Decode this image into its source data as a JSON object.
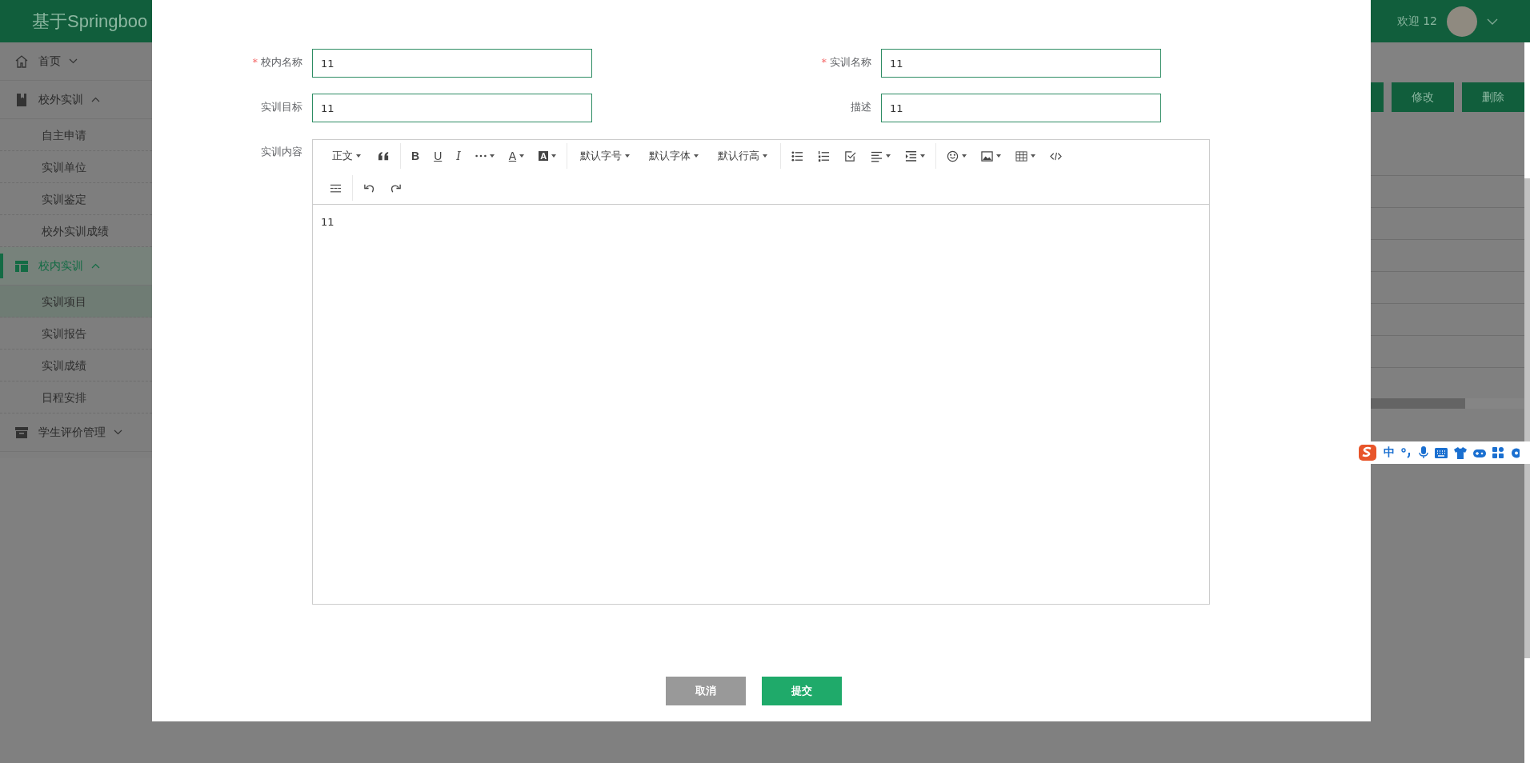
{
  "header": {
    "title": "基于Springboo",
    "welcome": "欢迎 12"
  },
  "sidebar": {
    "items": [
      {
        "label": "首页",
        "expanded": false,
        "selected": false
      },
      {
        "label": "校外实训",
        "expanded": true,
        "selected": false,
        "children": [
          {
            "label": "自主申请",
            "selected": false
          },
          {
            "label": "实训单位",
            "selected": false
          },
          {
            "label": "实训鉴定",
            "selected": false
          },
          {
            "label": "校外实训成绩",
            "selected": false
          }
        ]
      },
      {
        "label": "校内实训",
        "expanded": true,
        "selected": true,
        "children": [
          {
            "label": "实训项目",
            "selected": true
          },
          {
            "label": "实训报告",
            "selected": false
          },
          {
            "label": "实训成绩",
            "selected": false
          },
          {
            "label": "日程安排",
            "selected": false
          }
        ]
      },
      {
        "label": "学生评价管理",
        "expanded": false,
        "selected": false
      }
    ]
  },
  "background_buttons": [
    "修改",
    "删除"
  ],
  "modal": {
    "required_mark": "*",
    "fields": [
      {
        "label": "校内名称",
        "required": true,
        "value": "11"
      },
      {
        "label": "实训名称",
        "required": true,
        "value": "11"
      },
      {
        "label": "实训目标",
        "required": false,
        "value": "11"
      },
      {
        "label": "描述",
        "required": false,
        "value": "11"
      }
    ],
    "editor": {
      "label": "实训内容",
      "content": "11",
      "toolbar_rows": [
        [
          [
            {
              "kind": "dropdown",
              "label": "正文"
            },
            {
              "kind": "quote"
            }
          ],
          [
            {
              "kind": "bold",
              "label": "B"
            },
            {
              "kind": "underline",
              "label": "U"
            },
            {
              "kind": "italic",
              "label": "I"
            },
            {
              "kind": "more"
            },
            {
              "kind": "fontcolor",
              "label": "A"
            },
            {
              "kind": "bgcolor",
              "label": "A"
            }
          ],
          [
            {
              "kind": "dropdown",
              "label": "默认字号"
            },
            {
              "kind": "dropdown",
              "label": "默认字体"
            },
            {
              "kind": "dropdown",
              "label": "默认行高"
            }
          ],
          [
            {
              "kind": "bullets"
            },
            {
              "kind": "numbers"
            },
            {
              "kind": "todo"
            },
            {
              "kind": "align"
            },
            {
              "kind": "indent"
            }
          ],
          [
            {
              "kind": "emoji"
            },
            {
              "kind": "image"
            },
            {
              "kind": "table"
            },
            {
              "kind": "code"
            }
          ]
        ],
        [
          [
            {
              "kind": "divider"
            }
          ],
          [
            {
              "kind": "undo"
            },
            {
              "kind": "redo"
            }
          ]
        ]
      ]
    },
    "buttons": [
      {
        "label": "取消",
        "kind": "cancel"
      },
      {
        "label": "提交",
        "kind": "submit"
      }
    ]
  },
  "ime_bar": {
    "mode": "中"
  }
}
